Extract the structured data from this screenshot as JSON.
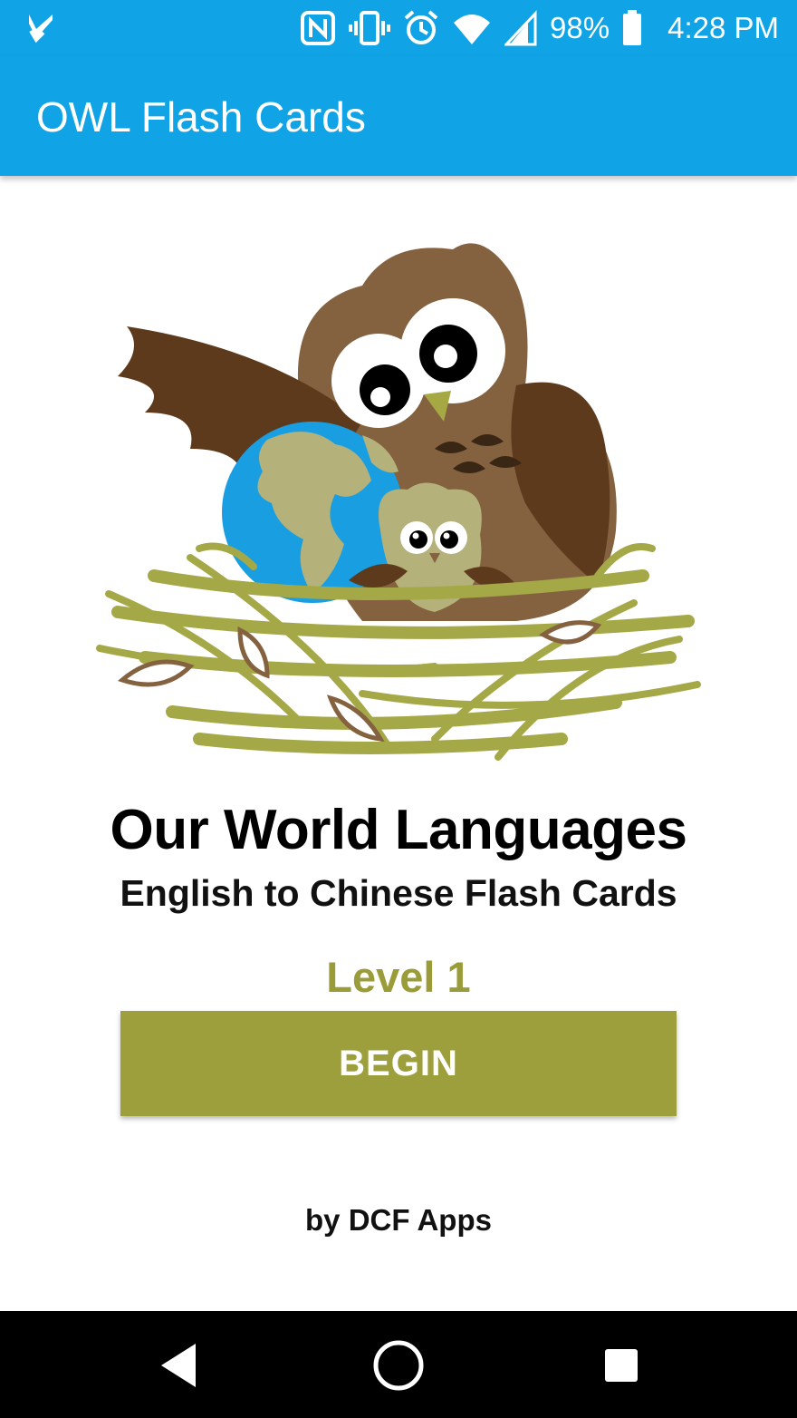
{
  "status_bar": {
    "battery": "98%",
    "time": "4:28 PM",
    "icons": [
      "app-notification-icon",
      "nfc-icon",
      "vibrate-icon",
      "alarm-icon",
      "wifi-icon",
      "signal-icon",
      "battery-icon"
    ]
  },
  "app_bar": {
    "title": "OWL Flash Cards"
  },
  "main": {
    "headline": "Our World Languages",
    "subtitle": "English to Chinese Flash Cards",
    "level": "Level 1",
    "begin_label": "BEGIN",
    "byline": "by DCF Apps"
  },
  "nav_bar": {
    "icons": [
      "back-icon",
      "home-icon",
      "recents-icon"
    ]
  },
  "colors": {
    "app_bar": "#10a3e5",
    "accent": "#9d9f3d",
    "level_text": "#9a9c3a",
    "owl_brown": "#84613f",
    "owl_dark": "#5e3a1c",
    "globe_blue": "#1a9ee2",
    "globe_land": "#b4b27a",
    "nest_green": "#a4a847"
  }
}
